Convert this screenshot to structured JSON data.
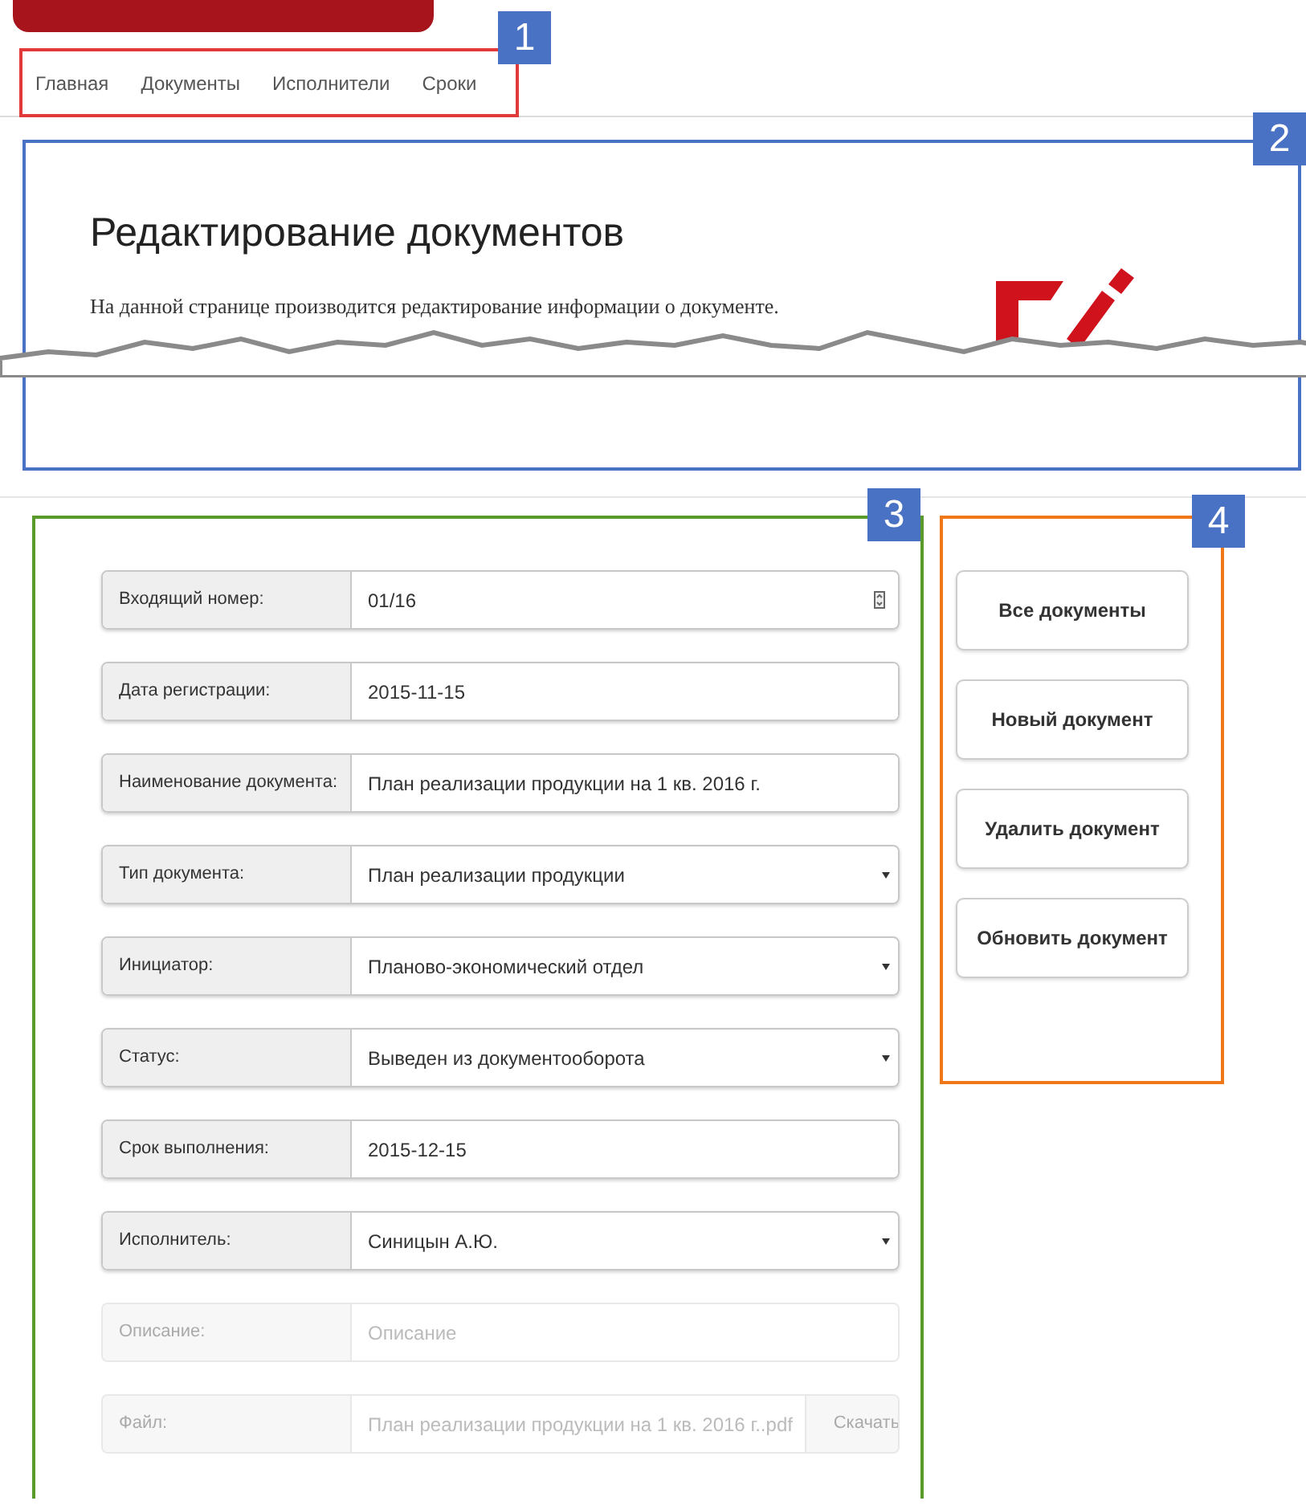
{
  "annotations": [
    {
      "number": "1",
      "color": "#e03a3a"
    },
    {
      "number": "2",
      "color": "#4a72c4"
    },
    {
      "number": "3",
      "color": "#5a9a2a"
    },
    {
      "number": "4",
      "color": "#f07818"
    }
  ],
  "nav": [
    "Главная",
    "Документы",
    "Исполнители",
    "Сроки"
  ],
  "header": {
    "title": "Редактирование документов",
    "description": "На данной странице производится редактирование информации о документе."
  },
  "form": {
    "fields": [
      {
        "kind": "number",
        "label": "Входящий номер:",
        "value": "01/16",
        "disabled": false
      },
      {
        "kind": "text",
        "label": "Дата регистрации:",
        "value": "2015-11-15",
        "disabled": false
      },
      {
        "kind": "text",
        "label": "Наименование документа:",
        "value": "План реализации продукции на 1 кв. 2016 г.",
        "disabled": false
      },
      {
        "kind": "select",
        "label": "Тип документа:",
        "value": "План реализации продукции",
        "disabled": false
      },
      {
        "kind": "select",
        "label": "Инициатор:",
        "value": "Планово-экономический отдел",
        "disabled": false
      },
      {
        "kind": "select",
        "label": "Статус:",
        "value": "Выведен из документооборота",
        "disabled": false
      },
      {
        "kind": "text",
        "label": "Срок выполнения:",
        "value": "2015-12-15",
        "disabled": false
      },
      {
        "kind": "select",
        "label": "Исполнитель:",
        "value": "Синицын А.Ю.",
        "disabled": false
      },
      {
        "kind": "text",
        "label": "Описание:",
        "placeholder": "Описание",
        "disabled": true
      },
      {
        "kind": "file",
        "label": "Файл:",
        "value": "План реализации продукции на 1 кв. 2016 г..pdf",
        "button": "Скачать",
        "disabled": true
      }
    ]
  },
  "actions": [
    "Все документы",
    "Новый документ",
    "Удалить документ",
    "Обновить документ"
  ]
}
